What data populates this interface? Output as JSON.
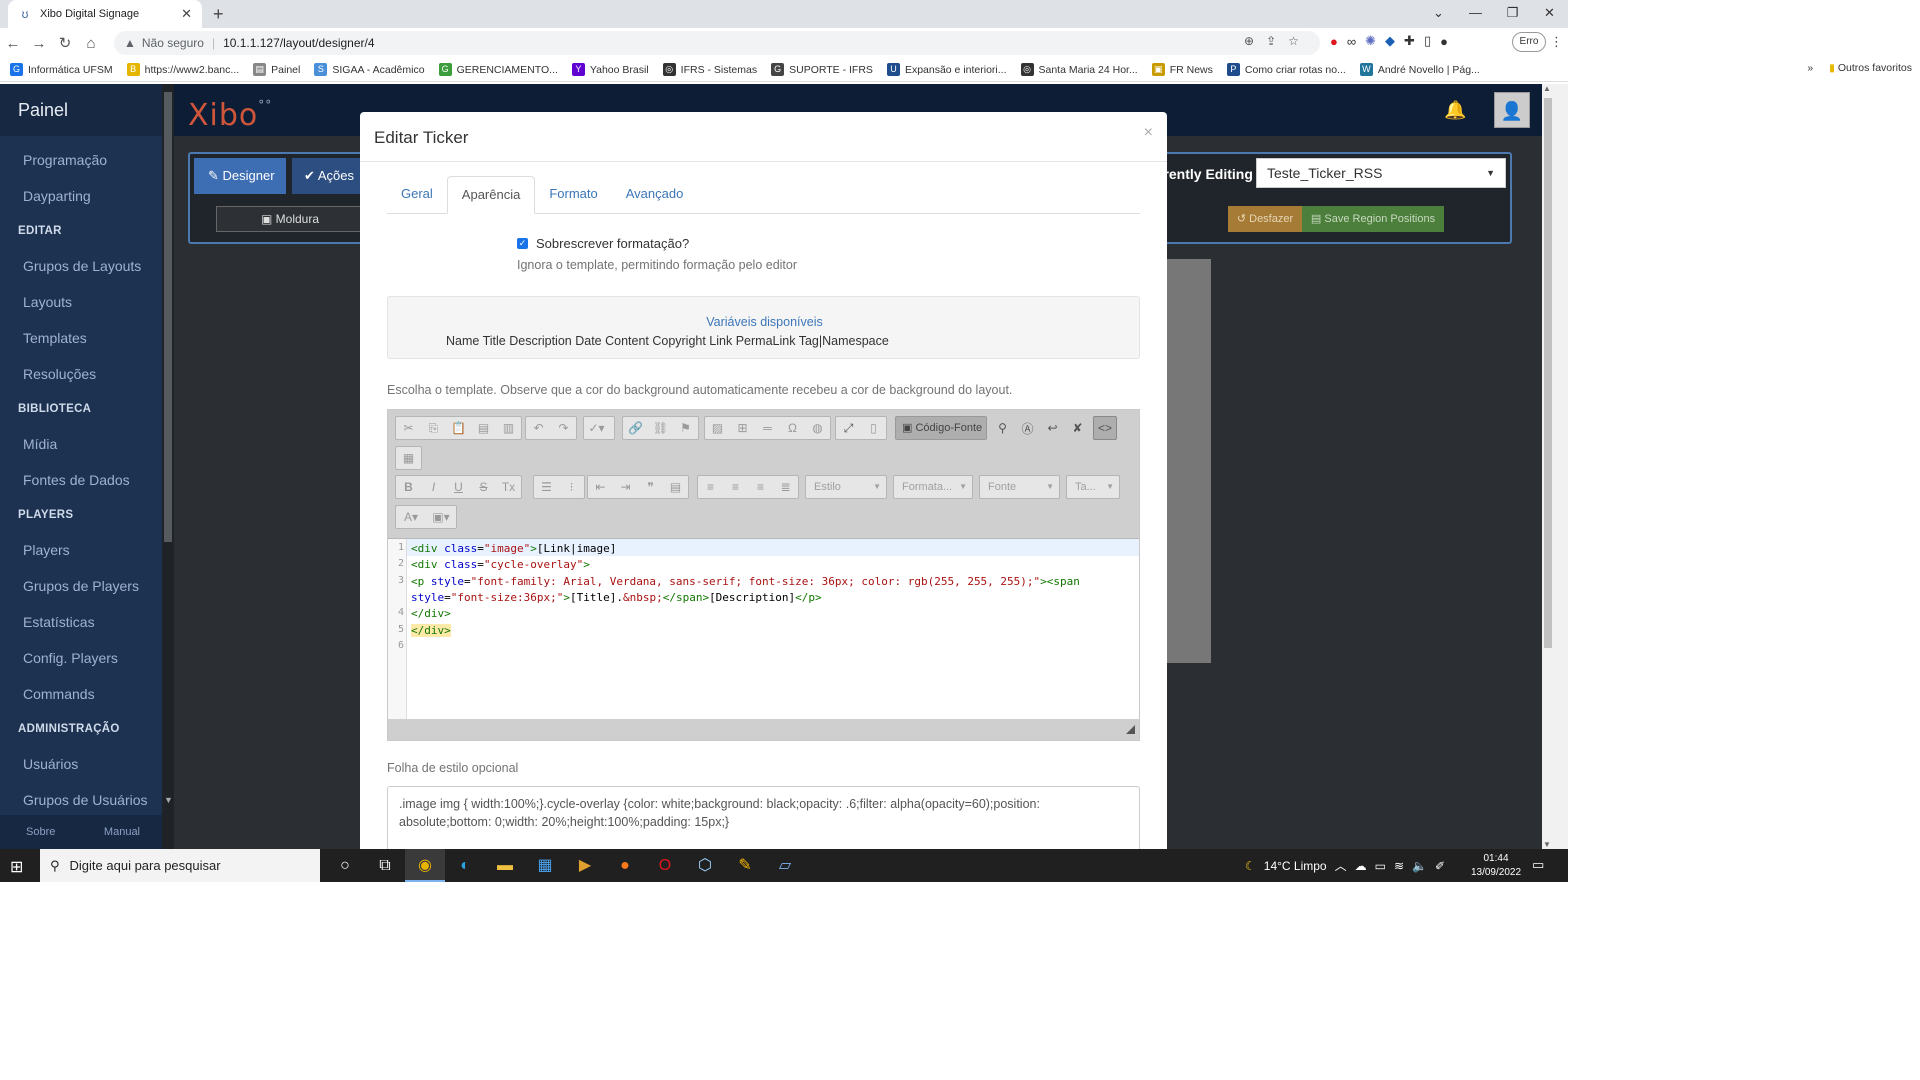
{
  "browser": {
    "tab_title": "Xibo Digital Signage",
    "security_label": "Não seguro",
    "url": "10.1.1.127/layout/designer/4",
    "profile_badge": "Erro",
    "bookmarks": [
      {
        "label": "Informática UFSM",
        "color": "#1a73e8",
        "glyph": "G"
      },
      {
        "label": "https://www2.banc...",
        "color": "#e4b600",
        "glyph": "B"
      },
      {
        "label": "Painel",
        "color": "#888888",
        "glyph": "▤"
      },
      {
        "label": "SIGAA - Acadêmico",
        "color": "#4a90d9",
        "glyph": "S"
      },
      {
        "label": "GERENCIAMENTO...",
        "color": "#3b9d3b",
        "glyph": "G"
      },
      {
        "label": "Yahoo Brasil",
        "color": "#5f01d1",
        "glyph": "Y"
      },
      {
        "label": "IFRS - Sistemas",
        "color": "#333333",
        "glyph": "◎"
      },
      {
        "label": "SUPORTE - IFRS",
        "color": "#444444",
        "glyph": "G"
      },
      {
        "label": "Expansão e interiori...",
        "color": "#1f4d8c",
        "glyph": "U"
      },
      {
        "label": "Santa Maria 24 Hor...",
        "color": "#333333",
        "glyph": "◎"
      },
      {
        "label": "FR News",
        "color": "#c89b00",
        "glyph": "▣"
      },
      {
        "label": "Como criar rotas no...",
        "color": "#1f4d8c",
        "glyph": "P"
      },
      {
        "label": "André Novello | Pág...",
        "color": "#21759b",
        "glyph": "W"
      }
    ],
    "bookmarks_other": "Outros favoritos"
  },
  "sidebar": {
    "brand": "Painel",
    "items": [
      {
        "type": "item",
        "label": "Programação"
      },
      {
        "type": "item",
        "label": "Dayparting"
      },
      {
        "type": "head",
        "label": "EDITAR"
      },
      {
        "type": "item",
        "label": "Grupos de Layouts"
      },
      {
        "type": "item",
        "label": "Layouts"
      },
      {
        "type": "item",
        "label": "Templates"
      },
      {
        "type": "item",
        "label": "Resoluções"
      },
      {
        "type": "head",
        "label": "BIBLIOTECA"
      },
      {
        "type": "item",
        "label": "Mídia"
      },
      {
        "type": "item",
        "label": "Fontes de Dados"
      },
      {
        "type": "head",
        "label": "PLAYERS"
      },
      {
        "type": "item",
        "label": "Players"
      },
      {
        "type": "item",
        "label": "Grupos de Players"
      },
      {
        "type": "item",
        "label": "Estatísticas"
      },
      {
        "type": "item",
        "label": "Config. Players"
      },
      {
        "type": "item",
        "label": "Commands"
      },
      {
        "type": "head",
        "label": "ADMINISTRAÇÃO"
      },
      {
        "type": "item",
        "label": "Usuários"
      },
      {
        "type": "item",
        "label": "Grupos de Usuários"
      }
    ],
    "footer_left": "Sobre",
    "footer_right": "Manual"
  },
  "header": {
    "logo": "Xibo"
  },
  "designer": {
    "tab_designer": "Designer",
    "tab_actions": "Ações",
    "moldura": "Moldura",
    "editing_label": "rrently Editing",
    "editing_value": "Teste_Ticker_RSS",
    "undo_label": "Desfazer",
    "save_label": "Save Region Positions"
  },
  "modal": {
    "title": "Editar Ticker",
    "close": "×",
    "tabs": [
      "Geral",
      "Aparência",
      "Formato",
      "Avançado"
    ],
    "active_tab": "Aparência",
    "override_label": "Sobrescrever formatação?",
    "override_checked": true,
    "override_help": "Ignora o template, permitindo formação pelo editor",
    "vars_title": "Variáveis disponíveis",
    "vars_list": "Name Title Description Date Content Copyright Link PermaLink Tag|Namespace",
    "template_help": "Escolha o template. Observe que a cor do background automaticamente recebeu a cor de background do layout.",
    "source_button": "Código-Fonte",
    "combo_style": "Estilo",
    "combo_format": "Formata...",
    "combo_font": "Fonte",
    "combo_size": "Ta...",
    "code_lines": [
      "1",
      "2",
      "3",
      "",
      "4",
      "5",
      "6"
    ],
    "css_label": "Folha de estilo opcional",
    "css_value": ".image img { width:100%;}.cycle-overlay {color: white;background: black;opacity: .6;filter: alpha(opacity=60);position: absolute;bottom: 0;width: 20%;height:100%;padding: 15px;}"
  },
  "taskbar": {
    "search_placeholder": "Digite aqui para pesquisar",
    "weather": "14°C  Limpo",
    "time": "01:44",
    "date": "13/09/2022"
  }
}
